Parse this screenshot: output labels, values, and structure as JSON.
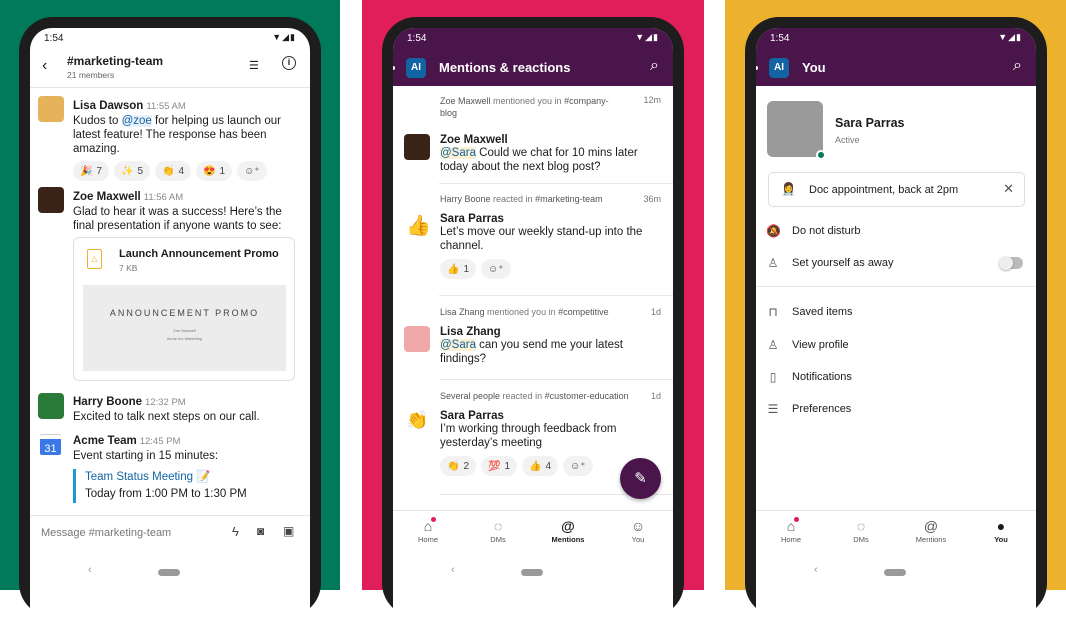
{
  "colors": {
    "panel1": "#007a5a",
    "panel2": "#e01e5a",
    "panel3": "#ecb22e",
    "aubergine": "#4a154b",
    "link": "#1264a3"
  },
  "status_time": "1:54",
  "channel": {
    "title": "#marketing-team",
    "members": "21 members",
    "messages": [
      {
        "name": "Lisa Dawson",
        "time": "11:55 AM",
        "text_pre": "Kudos to ",
        "mention": "@zoe",
        "text_post": " for helping us launch our latest feature! The response has been amazing.",
        "reactions": [
          {
            "emoji": "🎉",
            "count": "7"
          },
          {
            "emoji": "✨",
            "count": "5"
          },
          {
            "emoji": "👏",
            "count": "4"
          },
          {
            "emoji": "😍",
            "count": "1"
          }
        ]
      },
      {
        "name": "Zoe Maxwell",
        "time": "11:56 AM",
        "text": "Glad to hear it was a success! Here’s the final presentation if anyone wants to see:",
        "file": {
          "name": "Launch Announcement Promo",
          "size": "7 KB",
          "preview_title": "ANNOUNCEMENT PROMO",
          "preview_line1": "Zoe Maxwell",
          "preview_line2": "Acme Inc Marketing"
        }
      },
      {
        "name": "Harry Boone",
        "time": "12:32 PM",
        "text": "Excited to talk next steps on our call."
      },
      {
        "name": "Acme Team",
        "time": "12:45 PM",
        "text": "Event starting in 15 minutes:",
        "calendar_day": "31",
        "event_title": "Team Status Meeting",
        "event_emoji": "📝",
        "event_time": "Today from 1:00 PM to 1:30 PM"
      }
    ],
    "composer_placeholder": "Message #marketing-team"
  },
  "mentions": {
    "workspace": "AI",
    "title": "Mentions & reactions",
    "items": [
      {
        "actor": "Zoe Maxwell",
        "action": " mentioned you in ",
        "channel": "#company-blog",
        "age": "12m",
        "name": "Zoe Maxwell",
        "mention": "@Sara",
        "text": " Could we chat for 10 mins later today about the next blog post?"
      },
      {
        "actor": "Harry Boone",
        "action": " reacted in ",
        "channel": "#marketing-team",
        "age": "36m",
        "icon": "👍",
        "name": "Sara Parras",
        "text": "Let’s move our weekly stand-up into the channel.",
        "reactions": [
          {
            "emoji": "👍",
            "count": "1"
          }
        ]
      },
      {
        "actor": "Lisa Zhang",
        "action": " mentioned you in ",
        "channel": "#competitive",
        "age": "1d",
        "name": "Lisa Zhang",
        "mention": "@Sara",
        "text": " can you send me your latest findings?"
      },
      {
        "actor": "Several people",
        "action": " reacted in ",
        "channel": "#customer-education",
        "age": "1d",
        "icon": "👏",
        "name": "Sara Parras",
        "text": "I’m working through feedback from yesterday’s meeting",
        "reactions": [
          {
            "emoji": "👏",
            "count": "2"
          },
          {
            "emoji": "💯",
            "count": "1"
          },
          {
            "emoji": "👍",
            "count": "4"
          }
        ]
      }
    ]
  },
  "tabs": [
    "Home",
    "DMs",
    "Mentions",
    "You"
  ],
  "you": {
    "workspace": "AI",
    "title": "You",
    "name": "Sara Parras",
    "presence": "Active",
    "status_emoji": "👩‍⚕️",
    "status_text": "Doc appointment, back at 2pm",
    "dnd": "Do not disturb",
    "away": "Set yourself as away",
    "away_on": false,
    "menu": [
      "Saved items",
      "View profile",
      "Notifications",
      "Preferences"
    ]
  }
}
